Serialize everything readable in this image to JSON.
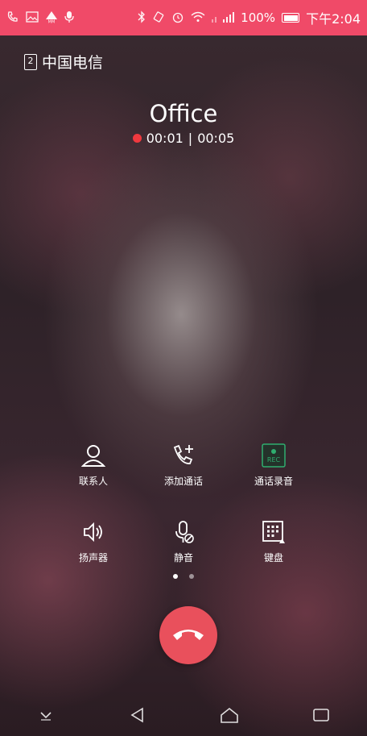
{
  "status_bar": {
    "battery_percent": "100%",
    "time": "下午2:04",
    "icons": [
      "phone-call-icon",
      "image-icon",
      "warning-mm-icon",
      "mic-icon",
      "bluetooth-icon",
      "vibrate-icon",
      "alarm-icon",
      "wifi-icon",
      "signal-icon",
      "battery-icon"
    ]
  },
  "carrier": {
    "sim_slot": "2",
    "name": "中国电信"
  },
  "call": {
    "contact_name": "Office",
    "elapsed": "00:01",
    "separator": "|",
    "duration": "00:05"
  },
  "controls": {
    "contacts": "联系人",
    "add_call": "添加通话",
    "record": "通话录音",
    "record_badge": "REC",
    "speaker": "扬声器",
    "mute": "静音",
    "keypad": "键盘"
  },
  "pager": {
    "count": 2,
    "active": 0
  },
  "colors": {
    "status_bar": "#f04a68",
    "end_call": "#e9505c",
    "rec_green": "#2fae6f",
    "rec_dot": "#f0393f"
  }
}
